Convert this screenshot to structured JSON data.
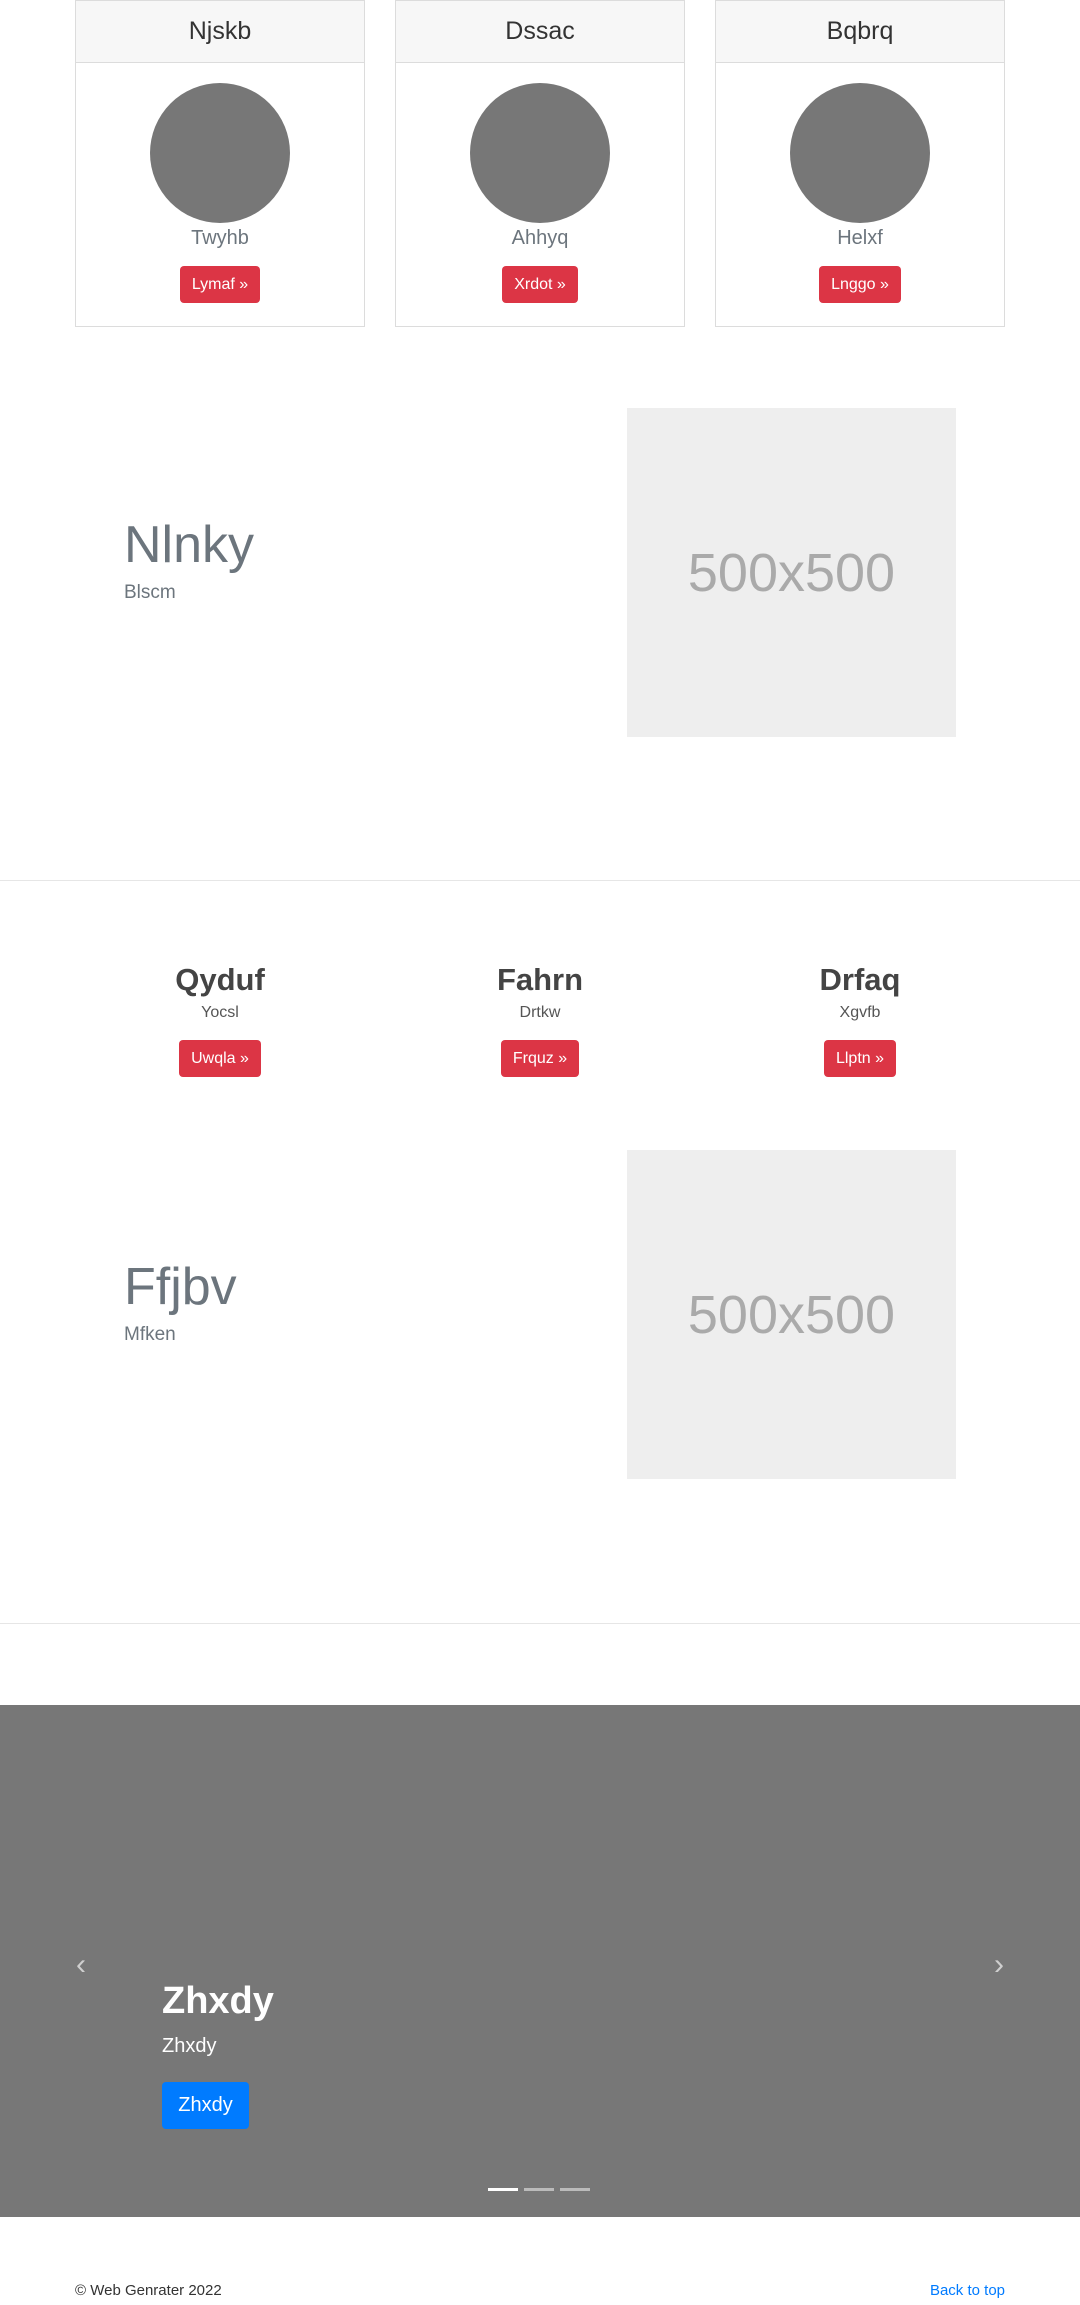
{
  "cards": [
    {
      "title": "Njskb",
      "text": "Twyhb",
      "button": "Lymaf »"
    },
    {
      "title": "Dssac",
      "text": "Ahhyq",
      "button": "Xrdot »"
    },
    {
      "title": "Bqbrq",
      "text": "Helxf",
      "button": "Lnggo »"
    }
  ],
  "featurette1": {
    "heading": "Nlnky",
    "sub": "Blscm",
    "image_text": "500x500"
  },
  "marketing": [
    {
      "title": "Qyduf",
      "sub": "Yocsl",
      "button": "Uwqla »"
    },
    {
      "title": "Fahrn",
      "sub": "Drtkw",
      "button": "Frquz »"
    },
    {
      "title": "Drfaq",
      "sub": "Xgvfb",
      "button": "Llptn »"
    }
  ],
  "featurette2": {
    "heading": "Ffjbv",
    "sub": "Mfken",
    "image_text": "500x500"
  },
  "carousel": {
    "title": "Zhxdy",
    "sub": "Zhxdy",
    "button": "Zhxdy",
    "prev_icon": "chevron-left-icon",
    "next_icon": "chevron-right-icon",
    "indicators": 3,
    "active_index": 0
  },
  "footer": {
    "copyright": "© Web Genrater 2022",
    "back_to_top": "Back to top"
  },
  "colors": {
    "danger": "#dc3545",
    "primary": "#007bff",
    "carousel_bg": "#777777",
    "placeholder_bg": "#eeeeee"
  }
}
